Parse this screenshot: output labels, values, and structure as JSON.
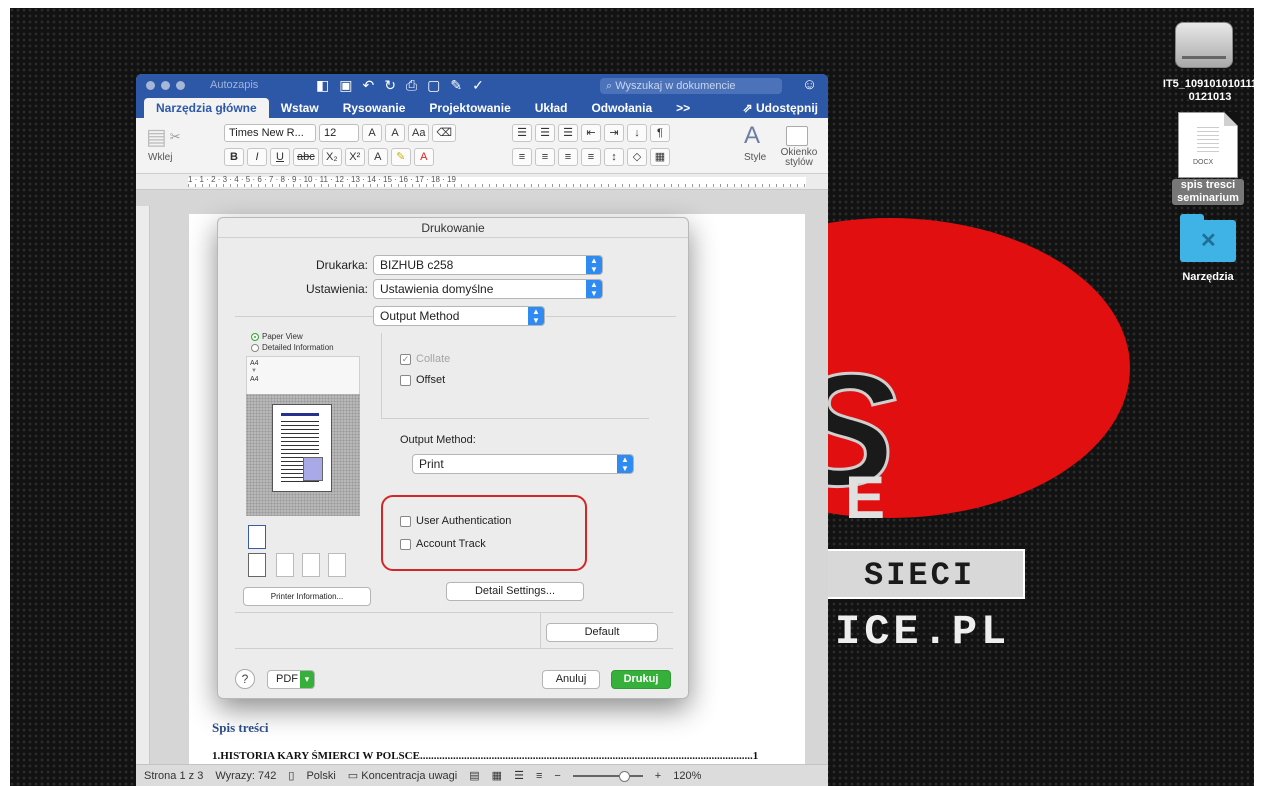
{
  "desktop": {
    "drive_label_1": "IT5_109101010111",
    "drive_label_2": "0121013",
    "doc_file_tag": "DOCX",
    "doc_file_label": "spis tresci seminarium",
    "folder_label": "Narzędzia",
    "wallpaper": {
      "letter_s": "S",
      "letter_e": "E",
      "band_text": "SIECI",
      "domain": "ICE.PL"
    }
  },
  "word": {
    "autosave": "Autozapis",
    "search_placeholder": "Wyszukaj w dokumencie",
    "tabs": [
      "Narzędzia główne",
      "Wstaw",
      "Rysowanie",
      "Projektowanie",
      "Układ",
      "Odwołania",
      ">>"
    ],
    "share": "Udostępnij",
    "ribbon": {
      "paste": "Wklej",
      "font_name": "Times New R...",
      "font_size": "12",
      "style": "Style",
      "styles_pane": "Okienko stylów"
    },
    "ruler_numbers": "1 · 1 · 2 · 3 · 4 · 5 · 6 · 7 · 8 · 9 · 10 · 11 · 12 · 13 · 14 · 15 · 16 · 17 · 18 · 19",
    "doc": {
      "toc_title": "Spis treści",
      "toc_entry": "1.HISTORIA KARY ŚMIERCI W POLSCE",
      "toc_page": "1"
    },
    "status": {
      "page": "Strona 1 z 3",
      "words": "Wyrazy: 742",
      "language": "Polski",
      "focus": "Koncentracja uwagi",
      "zoom": "120%"
    }
  },
  "dialog": {
    "title": "Drukowanie",
    "printer_label": "Drukarka:",
    "printer_value": "BIZHUB c258",
    "settings_label": "Ustawienia:",
    "settings_value": "Ustawienia domyślne",
    "section_value": "Output Method",
    "view_paper": "Paper View",
    "view_detailed": "Detailed Information",
    "paper_from": "A4",
    "paper_to": "A4",
    "collate": "Collate",
    "offset": "Offset",
    "output_method_label": "Output Method:",
    "output_method_value": "Print",
    "user_auth": "User Authentication",
    "account_track": "Account Track",
    "detail_settings": "Detail Settings...",
    "printer_info": "Printer Information...",
    "default": "Default",
    "help": "?",
    "pdf": "PDF",
    "cancel": "Anuluj",
    "print": "Drukuj"
  }
}
